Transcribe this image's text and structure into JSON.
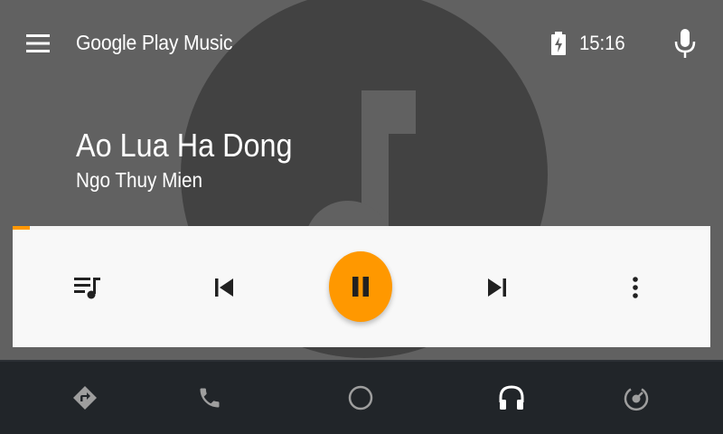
{
  "app": {
    "title": "Google Play Music"
  },
  "status": {
    "time": "15:16",
    "battery_icon": "battery-charging-icon"
  },
  "track": {
    "title": "Ao Lua Ha Dong",
    "artist": "Ngo Thuy Mien",
    "progress": 0.025
  },
  "controls": {
    "queue_icon": "queue-music-icon",
    "previous_icon": "skip-previous-icon",
    "play_state_icon": "pause-icon",
    "next_icon": "skip-next-icon",
    "more_icon": "more-vert-icon"
  },
  "bottom_nav": {
    "items": [
      "navigation-icon",
      "phone-icon",
      "home-icon",
      "headphones-icon",
      "exit-icon"
    ],
    "active": "headphones-icon"
  },
  "colors": {
    "accent": "#ff9800",
    "background": "#616161",
    "art": "#424242",
    "card": "#f8f8f8",
    "nav_bar": "#212529"
  }
}
